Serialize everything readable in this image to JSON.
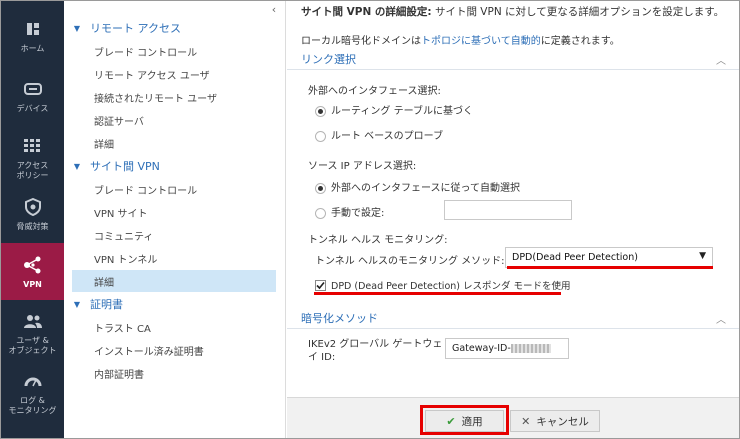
{
  "nav": [
    {
      "label": "ホーム",
      "icon": "home-icon"
    },
    {
      "label": "デバイス",
      "icon": "device-icon"
    },
    {
      "label_line1": "アクセス",
      "label_line2": "ポリシー",
      "icon": "grid-icon"
    },
    {
      "label": "脅威対策",
      "icon": "shield-icon"
    },
    {
      "label": "VPN",
      "icon": "vpn-icon",
      "active": true
    },
    {
      "label_line1": "ユーザ &",
      "label_line2": "オブジェクト",
      "icon": "users-icon"
    },
    {
      "label_line1": "ログ &",
      "label_line2": "モニタリング",
      "icon": "gauge-icon"
    }
  ],
  "tree": {
    "collapse_glyph": "‹",
    "sections": [
      {
        "label": "リモート アクセス",
        "items": [
          "ブレード コントロール",
          "リモート アクセス ユーザ",
          "接続されたリモート ユーザ",
          "認証サーバ",
          "詳細"
        ]
      },
      {
        "label": "サイト間 VPN",
        "items": [
          "ブレード コントロール",
          "VPN サイト",
          "コミュニティ",
          "VPN トンネル",
          "詳細"
        ]
      },
      {
        "label": "証明書",
        "items": [
          "トラスト CA",
          "インストール済み証明書",
          "内部証明書"
        ]
      }
    ],
    "selected": "サイト間 VPN / 詳細"
  },
  "main": {
    "intro_bold": "サイト間 VPN の詳細設定:",
    "intro_text": " サイト間 VPN に対して更なる詳細オプションを設定します。",
    "domain_prefix": "ローカル暗号化ドメインは",
    "domain_link": "トポロジに基づいて自動的",
    "domain_suffix": "に定義されます。",
    "link_section": "リンク選択",
    "ext_iface_label": "外部へのインタフェース選択:",
    "opt_routing": "ルーティング テーブルに基づく",
    "opt_route_probe": "ルート ベースのプローブ",
    "src_ip_label": "ソース IP アドレス選択:",
    "opt_auto": "外部へのインタフェースに従って自動選択",
    "opt_manual": "手動で設定:",
    "tunnel_health_label": "トンネル ヘルス モニタリング:",
    "tunnel_method_label": "トンネル ヘルスのモニタリング メソッド:",
    "tunnel_method_value": "DPD(Dead Peer Detection)",
    "dpd_responder": "DPD (Dead Peer Detection) レスポンダ モードを使用",
    "enc_section": "暗号化メソッド",
    "ikev2_line1": "IKEv2 グローバル ゲートウェ",
    "ikev2_line2": "イ ID:",
    "gateway_id": "Gateway-ID-"
  },
  "footer": {
    "apply": "適用",
    "cancel": "キャンセル"
  },
  "colors": {
    "nav_bg": "#1f2c3d",
    "nav_active": "#9b1b46",
    "accent": "#2e6fb7",
    "highlight": "#e60000"
  }
}
